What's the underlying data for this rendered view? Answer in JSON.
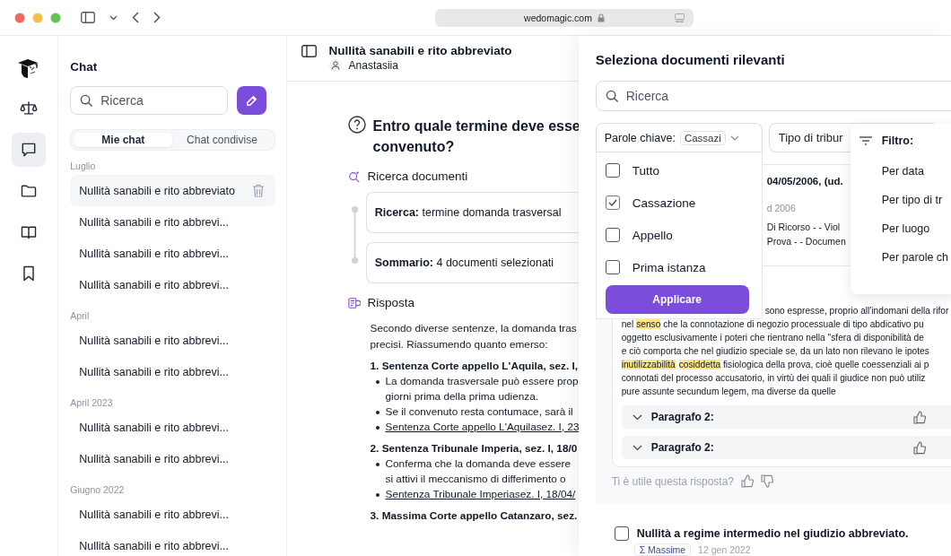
{
  "browser": {
    "url": "wedomagic.com"
  },
  "rail": {
    "items": [
      {
        "kind": "scales",
        "selected": false
      },
      {
        "kind": "chat",
        "selected": true
      },
      {
        "kind": "folder",
        "selected": false
      },
      {
        "kind": "book",
        "selected": false
      },
      {
        "kind": "bookmark",
        "selected": false
      }
    ]
  },
  "sidebar": {
    "title": "Chat",
    "search": {
      "placeholder": "Ricerca"
    },
    "tabs": [
      {
        "label": "Mie chat",
        "selected": true
      },
      {
        "label": "Chat condivise",
        "selected": false
      }
    ],
    "groups": [
      {
        "label": "Luglio",
        "items": [
          {
            "title": "Nullità sanabili e rito abbreviato",
            "selected": true
          },
          {
            "title": "Nullità sanabili e rito abbrevi...",
            "selected": false
          },
          {
            "title": "Nullità sanabili e rito abbrevi...",
            "selected": false
          },
          {
            "title": "Nullità sanabili e rito abbrevi...",
            "selected": false
          }
        ]
      },
      {
        "label": "April",
        "items": [
          {
            "title": "Nullità sanabili e rito abbrevi...",
            "selected": false
          },
          {
            "title": "Nullità sanabili e rito abbrevi...",
            "selected": false
          }
        ]
      },
      {
        "label": "April 2023",
        "items": [
          {
            "title": "Nullità sanabili e rito abbrevi...",
            "selected": false
          },
          {
            "title": "Nullità sanabili e rito abbrevi...",
            "selected": false
          }
        ]
      },
      {
        "label": "Giugno 2022",
        "items": [
          {
            "title": "Nullità sanabili e rito abbrevi...",
            "selected": false
          },
          {
            "title": "Nullità sanabili e rito abbrevi...",
            "selected": false
          }
        ]
      }
    ]
  },
  "chat": {
    "title": "Nullità sanabili e rito abbreviato",
    "user": "Anastasiia",
    "question_lines": [
      "Entro quale termine deve esse",
      "convenuto?"
    ],
    "search_label": "Ricerca documenti",
    "steps": [
      "**Ricerca:** termine domanda trasversal",
      "**Sommario:** 4 documenti selezionati"
    ],
    "answer_label": "Risposta",
    "intro_lines": [
      "Secondo diverse sentenze, la domanda tras",
      "precisi. Riassumendo quanto emerso:"
    ],
    "sections": [
      {
        "number": "1.",
        "title": "Sentenza Corte appello L'Aquila, sez. I,",
        "bullets": [
          {
            "kind": "text",
            "lines": [
              "La domanda trasversale può essere prop",
              "giorni prima della prima udienza."
            ]
          },
          {
            "kind": "text",
            "lines": [
              "Se il convenuto resta contumace, sarà il"
            ]
          },
          {
            "kind": "link",
            "lines": [
              "Sentenza Corte appello L'Aquilasez. I, 23"
            ]
          }
        ]
      },
      {
        "number": "2.",
        "title": "Sentenza Tribunale Imperia, sez. I, 18/0",
        "bullets": [
          {
            "kind": "text",
            "lines": [
              "Conferma che la domanda deve essere",
              "si attivi il meccanismo di differimento o"
            ]
          },
          {
            "kind": "link",
            "lines": [
              "Sentenza Tribunale Imperiasez. I, 18/04/"
            ]
          }
        ]
      },
      {
        "number": "3.",
        "title": "Massima Corte appello Catanzaro, sez."
      }
    ]
  },
  "drawer": {
    "title": "Seleziona documenti rilevanti",
    "search": {
      "placeholder": "Ricerca"
    },
    "keyword_filter": {
      "label": "Parole chiave:",
      "value": "Cassazi",
      "apply": "Applicare",
      "options": [
        {
          "label": "Tutto",
          "checked": false
        },
        {
          "label": "Cassazione",
          "checked": true
        },
        {
          "label": "Appello",
          "checked": false
        },
        {
          "label": "Prima istanza",
          "checked": false
        }
      ]
    },
    "court_filter": {
      "label": "Tipo di tribur"
    },
    "sort_menu": {
      "label": "Filtro:",
      "items": [
        "Per data",
        "Per tipo di tr",
        "Per luogo",
        "Per parole ch"
      ]
    },
    "document": {
      "title": "04/05/2006, (ud.",
      "date": "d 2006",
      "tag_lines": [
        "Di Ricorso - - Viol",
        "Prova - - Documen"
      ]
    },
    "excerpt": {
      "lines": [
        {
          "segments": [
            {
              "text": "sono espresse, proprio all'indomani della rifor",
              "highlighted": false
            }
          ]
        },
        {
          "segments": [
            {
              "text": "nel ",
              "highlighted": false
            },
            {
              "text": "senso",
              "highlighted": true
            },
            {
              "text": " che la connotazione di negozio processuale di tipo abdicativo pu",
              "highlighted": false
            }
          ]
        },
        {
          "segments": [
            {
              "text": "oggetto esclusivamente i poteri che rientrano nella \"sfera di disponibilità de",
              "highlighted": false
            }
          ]
        },
        {
          "segments": [
            {
              "text": "e ciò comporta che nel giudizio speciale se, da un lato non rilevano le ipotes",
              "highlighted": false
            }
          ]
        },
        {
          "segments": [
            {
              "text": "inutilizzabilità",
              "highlighted": true
            },
            {
              "text": "cosiddetta",
              "highlighted": true
            },
            {
              "text": " fisiologica della prova, cioè quelle coessenziali ai p",
              "highlighted": false
            }
          ]
        },
        {
          "segments": [
            {
              "text": "connotati del processo accusatorio, in virtù dei quali il giudice non può utiliz",
              "highlighted": false
            }
          ]
        },
        {
          "segments": [
            {
              "text": "pure assunte secundum legem, ma diverse da quelle",
              "highlighted": false
            }
          ]
        }
      ],
      "paragraphs": [
        "Paragrafo 2:",
        "Paragrafo 2:"
      ]
    },
    "feedback": "Ti è utile questa risposta?",
    "next_document": {
      "title": "Nullità a regime intermedio nel giudizio abbreviato.",
      "checked": false,
      "tag_icon": "Σ",
      "tag": "Massime",
      "date": "12 gen 2022"
    }
  }
}
